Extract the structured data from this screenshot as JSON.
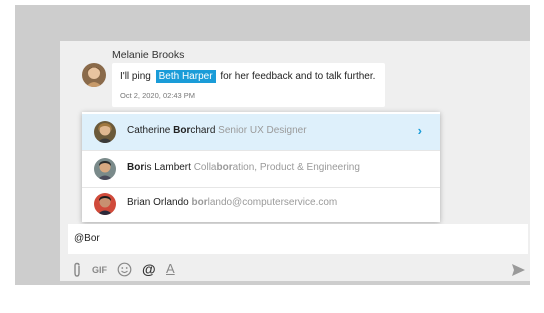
{
  "message": {
    "sender": "Melanie Brooks",
    "text_before": "I'll ping",
    "mention": "Beth Harper",
    "text_after": "for her feedback and to talk further.",
    "timestamp": "Oct 2, 2020, 02:43 PM"
  },
  "suggestions": [
    {
      "name_pre": "Catherine ",
      "name_match": "Bor",
      "name_post": "chard",
      "sub_pre": "Senior UX Designer",
      "sub_match": "",
      "sub_post": "",
      "active": true
    },
    {
      "name_pre": "",
      "name_match": "Bor",
      "name_post": "is Lambert",
      "sub_pre": "Colla",
      "sub_match": "bor",
      "sub_post": "ation, Product & Engineering",
      "active": false
    },
    {
      "name_pre": "Brian Orlando",
      "name_match": "",
      "name_post": "",
      "sub_pre": "",
      "sub_match": "bor",
      "sub_post": "lando@computerservice.com",
      "active": false
    }
  ],
  "input": {
    "value": "@Bor"
  },
  "toolbar": {
    "gif_label": "GIF",
    "at_label": "@",
    "format_label": "A"
  },
  "icons": {
    "chevron": "chevron-right-icon",
    "attach": "paperclip-icon",
    "emoji": "smiley-icon",
    "send": "send-icon"
  },
  "colors": {
    "accent": "#1a9cd8",
    "active_row": "#def0fb"
  }
}
